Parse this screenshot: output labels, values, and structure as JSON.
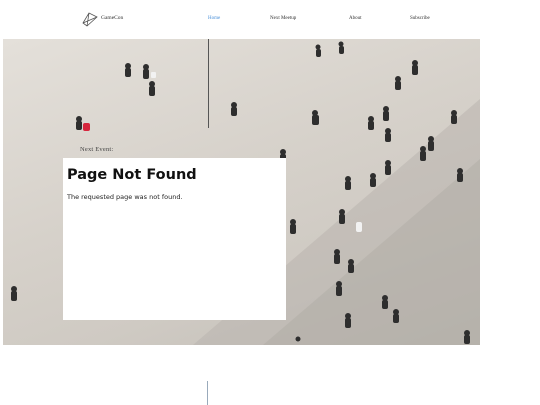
{
  "brand": {
    "name": "GameCon",
    "logo_icon": "constellation-logo-icon"
  },
  "nav": {
    "items": [
      {
        "label": "Home",
        "active": true
      },
      {
        "label": "Next Meetup",
        "active": false
      },
      {
        "label": "About",
        "active": false
      },
      {
        "label": "Subscribe",
        "active": false
      }
    ]
  },
  "hero": {
    "next_event_label": "Next Event:"
  },
  "error_panel": {
    "title": "Page Not Found",
    "message": "The requested page was not found."
  },
  "colors": {
    "nav_active": "#4a90d9",
    "hero_pavement": "#d6d1ca"
  }
}
